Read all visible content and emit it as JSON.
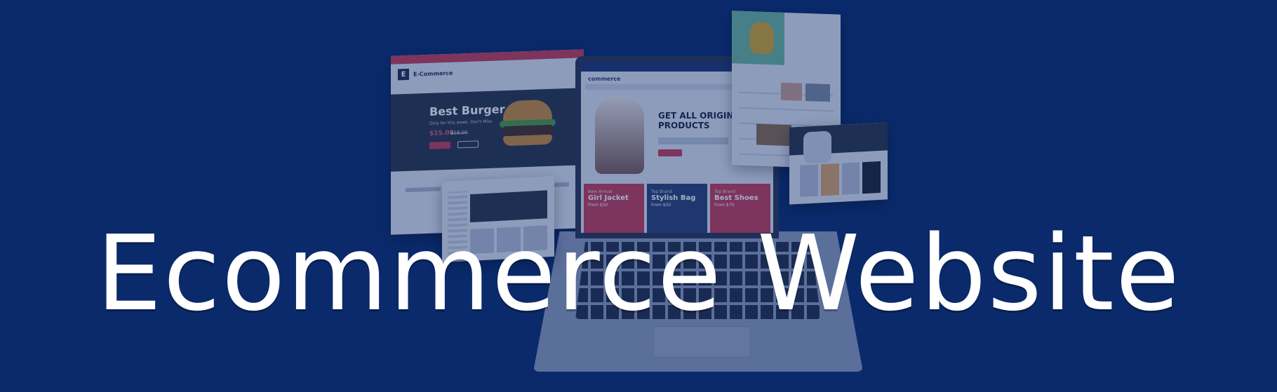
{
  "banner": {
    "headline": "Ecommerce Website",
    "background_color": "#0a2a6b",
    "text_color": "#ffffff"
  },
  "laptop_screen": {
    "brand": "commerce",
    "hero_heading": "GET ALL ORIGINAL PRODUCTS",
    "tiles": [
      {
        "kicker": "New Arrival",
        "title": "Girl Jacket",
        "price": "From $50"
      },
      {
        "kicker": "Top Brand",
        "title": "Stylish Bag",
        "price": "From $50"
      },
      {
        "kicker": "Top Brand",
        "title": "Best Shoes",
        "price": "From $70"
      }
    ]
  },
  "burger_card": {
    "brand": "E-Commerce",
    "logo_letter": "E",
    "title": "Best Burger",
    "subtitle": "Only for this week, Don't Miss",
    "price": "$15.00",
    "old_price": "$18.00"
  },
  "colors": {
    "accent_red": "#c43a55",
    "navy_panel": "#2b3346"
  }
}
